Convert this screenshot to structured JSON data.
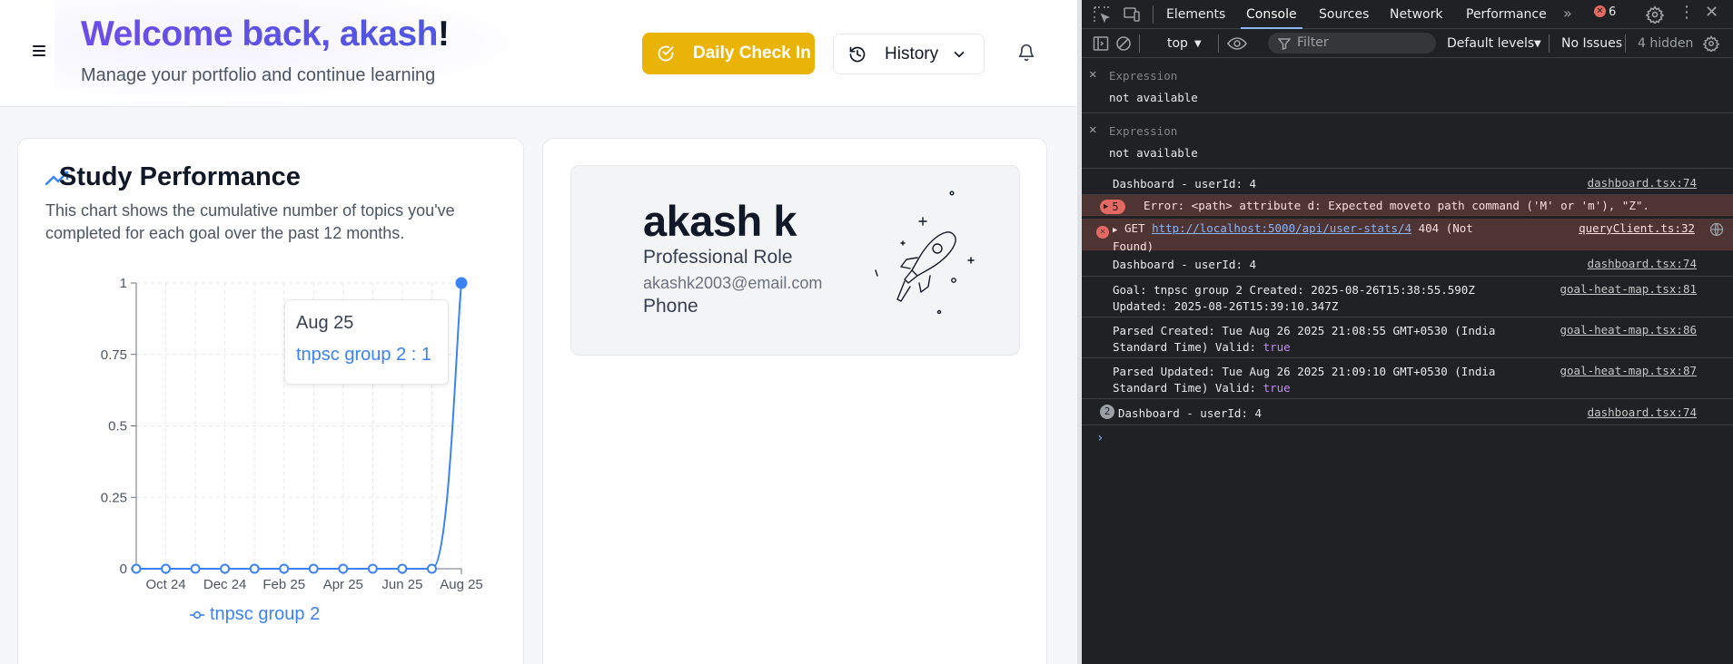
{
  "app": {
    "welcome_prefix": "Welcome back, akash",
    "welcome_suffix": "!",
    "subtitle": "Manage your portfolio and continue learning",
    "checkin_label": "Daily Check In",
    "history_label": "History"
  },
  "performance": {
    "title": "Study Performance",
    "description": "This chart shows the cumulative number of topics you've completed for each goal over the past 12 months.",
    "tooltip_date": "Aug 25",
    "tooltip_value": "tnpsc group 2 : 1",
    "legend_label": "tnpsc group 2"
  },
  "chart_data": {
    "type": "line",
    "x_ticks": [
      "Oct 24",
      "Dec 24",
      "Feb 25",
      "Apr 25",
      "Jun 25",
      "Aug 25"
    ],
    "y_ticks": [
      "0",
      "0.25",
      "0.5",
      "0.75",
      "1"
    ],
    "ylim": [
      0,
      1
    ],
    "series": [
      {
        "name": "tnpsc group 2",
        "values": [
          0,
          0,
          0,
          0,
          0,
          0,
          0,
          0,
          0,
          0,
          0,
          1
        ]
      }
    ],
    "grid": true,
    "legend": "bottom"
  },
  "profile": {
    "name": "akash k",
    "role": "Professional Role",
    "email": "akashk2003@email.com",
    "phone": "Phone"
  },
  "devtools": {
    "tabs": [
      "Elements",
      "Console",
      "Sources",
      "Network",
      "Performance"
    ],
    "active_tab": "Console",
    "error_count": "6",
    "context": "top",
    "filter_placeholder": "Filter",
    "levels": "Default levels",
    "issues": "No Issues",
    "hidden": "4 hidden",
    "expressions": [
      {
        "label": "Expression",
        "value": "not available"
      },
      {
        "label": "Expression",
        "value": "not available"
      }
    ],
    "messages": {
      "m1": {
        "text": "Dashboard - userId: 4",
        "src": "dashboard.tsx:74"
      },
      "m2": {
        "count": "5",
        "text": "Error: <path> attribute d: Expected moveto path command ('M' or 'm'), \"Z\"."
      },
      "m3": {
        "method": "GET",
        "url": "http://localhost:5000/api/user-stats/4",
        "status": "404 (Not",
        "status2": "Found)",
        "src": "queryClient.ts:32"
      },
      "m4": {
        "text": "Dashboard - userId: 4",
        "src": "dashboard.tsx:74"
      },
      "m5": {
        "line1": "Goal: tnpsc group 2 Created: 2025-08-26T15:38:55.590Z",
        "line2": "Updated: 2025-08-26T15:39:10.347Z",
        "src": "goal-heat-map.tsx:81"
      },
      "m6": {
        "line1": "Parsed Created: Tue Aug 26 2025 21:08:55 GMT+0530 (India",
        "line2": "Standard Time) Valid: ",
        "bool": "true",
        "src": "goal-heat-map.tsx:86"
      },
      "m7": {
        "line1": "Parsed Updated: Tue Aug 26 2025 21:09:10 GMT+0530 (India",
        "line2": "Standard Time) Valid: ",
        "bool": "true",
        "src": "goal-heat-map.tsx:87"
      },
      "m8": {
        "count": "2",
        "text": "Dashboard - userId: 4",
        "src": "dashboard.tsx:74"
      }
    }
  }
}
